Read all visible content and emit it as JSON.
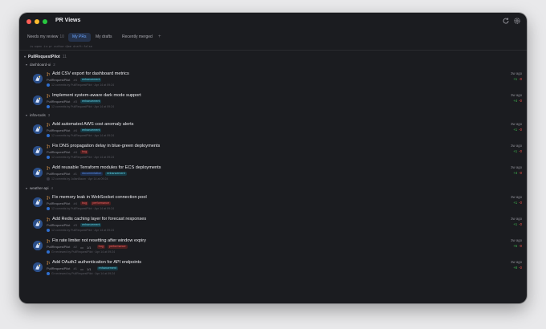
{
  "window": {
    "title": "PR Views"
  },
  "tabs": [
    {
      "label": "Needs my review",
      "count": "10"
    },
    {
      "label": "My PRs",
      "count": ""
    },
    {
      "label": "My drafts",
      "count": ""
    },
    {
      "label": "Recently merged",
      "count": ""
    }
  ],
  "tab_add": "+",
  "query": "is:open is:pr author:@me draft:false",
  "user": {
    "name": "PullRequestPilot",
    "count": "11"
  },
  "repos": [
    {
      "name": "dashboard-ui",
      "count": "2"
    },
    {
      "name": "infra-tools",
      "count": "3"
    },
    {
      "name": "weather-api",
      "count": "4"
    }
  ],
  "prs": [
    {
      "title": "Add CSV export for dashboard metrics",
      "author": "PullRequestPilot",
      "num": "#4",
      "comments": "",
      "labels": [
        {
          "text": "enhancement",
          "kind": "enh"
        }
      ],
      "activity": "12 commits by PullRequestPilot · Apr 14 at 09:24",
      "ago": "3w ago",
      "add": "+1",
      "del": "-0"
    },
    {
      "title": "Implement system-aware dark mode support",
      "author": "PullRequestPilot",
      "num": "#3",
      "comments": "",
      "labels": [
        {
          "text": "enhancement",
          "kind": "enh"
        }
      ],
      "activity": "12 commits by PullRequestPilot · Apr 14 at 09:24",
      "ago": "3w ago",
      "add": "+4",
      "del": "-0"
    },
    {
      "title": "Add automated AWS cost anomaly alerts",
      "author": "PullRequestPilot",
      "num": "#4",
      "comments": "",
      "labels": [
        {
          "text": "enhancement",
          "kind": "enh"
        }
      ],
      "activity": "12 commits by PullRequestPilot · Apr 14 at 09:24",
      "ago": "3w ago",
      "add": "+1",
      "del": "-0"
    },
    {
      "title": "Fix DNS propagation delay in blue-green deployments",
      "author": "PullRequestPilot",
      "num": "#4",
      "comments": "",
      "labels": [
        {
          "text": "bug",
          "kind": "bug"
        }
      ],
      "activity": "12 commits by PullRequestPilot · Apr 14 at 09:24",
      "ago": "3w ago",
      "add": "+1",
      "del": "-0"
    },
    {
      "title": "Add reusable Terraform modules for ECS deployments",
      "author": "PullRequestPilot",
      "num": "#1",
      "comments": "",
      "labels": [
        {
          "text": "documentation",
          "kind": "infra"
        },
        {
          "text": "enhancement",
          "kind": "enh"
        }
      ],
      "activity": "12 commits by JulianBaum · Apr 14 at 09:24",
      "ago": "3w ago",
      "add": "+4",
      "del": "-0"
    },
    {
      "title": "Fix memory leak in WebSocket connection pool",
      "author": "PullRequestPilot",
      "num": "#4",
      "comments": "",
      "labels": [
        {
          "text": "bug",
          "kind": "bug"
        },
        {
          "text": "performance",
          "kind": "perf"
        }
      ],
      "activity": "12 commits by PullRequestPilot · Apr 14 at 09:24",
      "ago": "3w ago",
      "add": "+1",
      "del": "-0"
    },
    {
      "title": "Add Redis caching layer for forecast responses",
      "author": "PullRequestPilot",
      "num": "#3",
      "comments": "",
      "labels": [
        {
          "text": "enhancement",
          "kind": "enh"
        }
      ],
      "activity": "12 commits by PullRequestPilot · Apr 14 at 09:24",
      "ago": "3w ago",
      "add": "+1",
      "del": "-0"
    },
    {
      "title": "Fix rate limiter not resetting after window expiry",
      "author": "PullRequestPilot",
      "num": "#2",
      "comments": "1/1",
      "labels": [
        {
          "text": "bug",
          "kind": "bug"
        },
        {
          "text": "performance",
          "kind": "perf"
        }
      ],
      "activity": "Gr reviewed by PullRequestPilot · Apr 14 at 09:24",
      "ago": "3w ago",
      "add": "+6",
      "del": "-0"
    },
    {
      "title": "Add OAuth2 authentication for API endpoints",
      "author": "PullRequestPilot",
      "num": "#1",
      "comments": "1/1",
      "labels": [
        {
          "text": "enhancement",
          "kind": "enh"
        }
      ],
      "activity": "Gr reviewed by PullRequestPilot · Apr 14 at 09:24",
      "ago": "3w ago",
      "add": "+8",
      "del": "-0"
    }
  ]
}
